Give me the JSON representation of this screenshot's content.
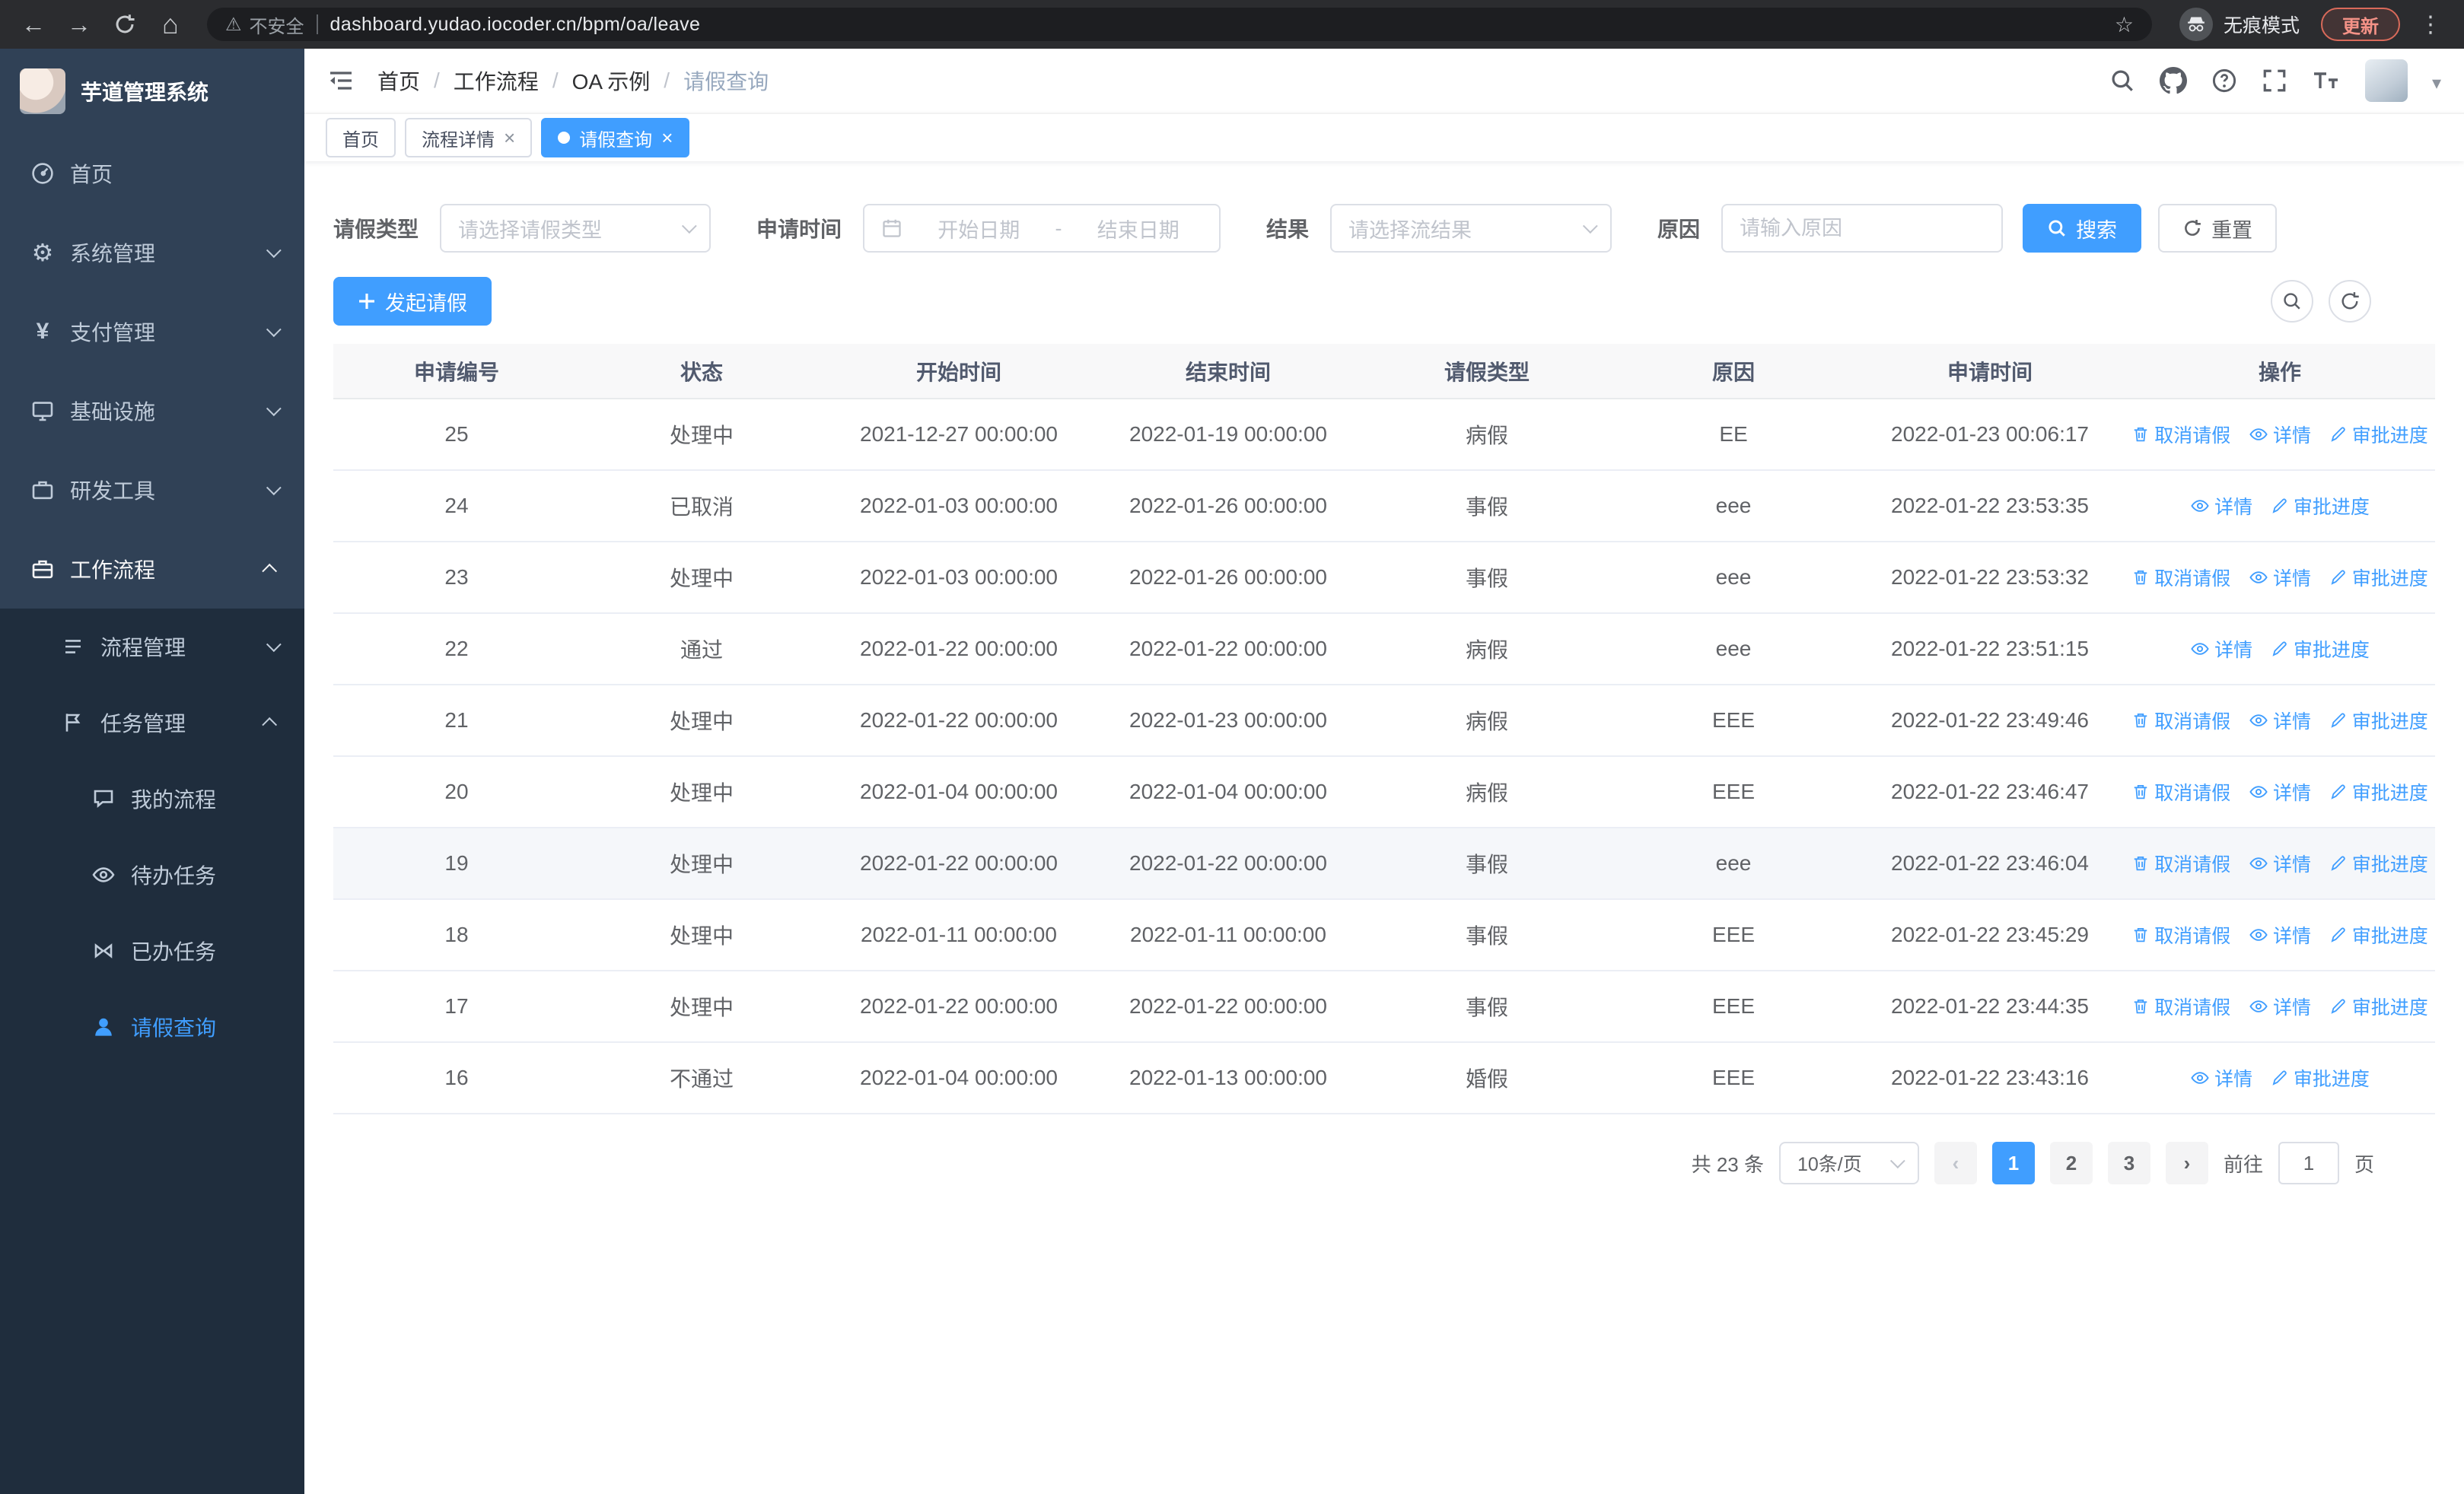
{
  "browser": {
    "security_label": "不安全",
    "url": "dashboard.yudao.iocoder.cn/bpm/oa/leave",
    "incognito_label": "无痕模式",
    "update_label": "更新"
  },
  "sidebar": {
    "title": "芋道管理系统",
    "menu": [
      {
        "label": "首页",
        "icon": "dashboard-icon"
      },
      {
        "label": "系统管理",
        "icon": "gear-icon"
      },
      {
        "label": "支付管理",
        "icon": "yen-icon"
      },
      {
        "label": "基础设施",
        "icon": "infrastructure-icon"
      },
      {
        "label": "研发工具",
        "icon": "tools-icon"
      },
      {
        "label": "工作流程",
        "icon": "workflow-icon"
      }
    ],
    "submenu": [
      {
        "label": "流程管理",
        "icon": "process-icon"
      },
      {
        "label": "任务管理",
        "icon": "task-icon"
      }
    ],
    "task_children": [
      {
        "label": "我的流程",
        "icon": "chat-icon"
      },
      {
        "label": "待办任务",
        "icon": "eye-icon"
      },
      {
        "label": "已办任务",
        "icon": "done-icon"
      },
      {
        "label": "请假查询",
        "icon": "user-icon",
        "active": true
      }
    ]
  },
  "header": {
    "breadcrumb": [
      "首页",
      "工作流程",
      "OA 示例",
      "请假查询"
    ]
  },
  "tabs": [
    {
      "label": "首页"
    },
    {
      "label": "流程详情",
      "closable": true
    },
    {
      "label": "请假查询",
      "closable": true,
      "active": true
    }
  ],
  "filters": {
    "leave_type_label": "请假类型",
    "leave_type_placeholder": "请选择请假类型",
    "apply_time_label": "申请时间",
    "start_date_placeholder": "开始日期",
    "date_separator": "-",
    "end_date_placeholder": "结束日期",
    "result_label": "结果",
    "result_placeholder": "请选择流结果",
    "reason_label": "原因",
    "reason_placeholder": "请输入原因",
    "search_button": "搜索",
    "reset_button": "重置"
  },
  "toolbar": {
    "create_button": "发起请假"
  },
  "table": {
    "columns": [
      "申请编号",
      "状态",
      "开始时间",
      "结束时间",
      "请假类型",
      "原因",
      "申请时间",
      "操作"
    ],
    "actions": {
      "cancel": "取消请假",
      "detail": "详情",
      "progress": "审批进度"
    },
    "rows": [
      {
        "id": "25",
        "status": "处理中",
        "start": "2021-12-27 00:00:00",
        "end": "2022-01-19 00:00:00",
        "type": "病假",
        "reason": "EE",
        "applied": "2022-01-23 00:06:17",
        "cancellable": true
      },
      {
        "id": "24",
        "status": "已取消",
        "start": "2022-01-03 00:00:00",
        "end": "2022-01-26 00:00:00",
        "type": "事假",
        "reason": "eee",
        "applied": "2022-01-22 23:53:35",
        "cancellable": false
      },
      {
        "id": "23",
        "status": "处理中",
        "start": "2022-01-03 00:00:00",
        "end": "2022-01-26 00:00:00",
        "type": "事假",
        "reason": "eee",
        "applied": "2022-01-22 23:53:32",
        "cancellable": true
      },
      {
        "id": "22",
        "status": "通过",
        "start": "2022-01-22 00:00:00",
        "end": "2022-01-22 00:00:00",
        "type": "病假",
        "reason": "eee",
        "applied": "2022-01-22 23:51:15",
        "cancellable": false
      },
      {
        "id": "21",
        "status": "处理中",
        "start": "2022-01-22 00:00:00",
        "end": "2022-01-23 00:00:00",
        "type": "病假",
        "reason": "EEE",
        "applied": "2022-01-22 23:49:46",
        "cancellable": true
      },
      {
        "id": "20",
        "status": "处理中",
        "start": "2022-01-04 00:00:00",
        "end": "2022-01-04 00:00:00",
        "type": "病假",
        "reason": "EEE",
        "applied": "2022-01-22 23:46:47",
        "cancellable": true
      },
      {
        "id": "19",
        "status": "处理中",
        "start": "2022-01-22 00:00:00",
        "end": "2022-01-22 00:00:00",
        "type": "事假",
        "reason": "eee",
        "applied": "2022-01-22 23:46:04",
        "cancellable": true,
        "highlighted": true
      },
      {
        "id": "18",
        "status": "处理中",
        "start": "2022-01-11 00:00:00",
        "end": "2022-01-11 00:00:00",
        "type": "事假",
        "reason": "EEE",
        "applied": "2022-01-22 23:45:29",
        "cancellable": true
      },
      {
        "id": "17",
        "status": "处理中",
        "start": "2022-01-22 00:00:00",
        "end": "2022-01-22 00:00:00",
        "type": "事假",
        "reason": "EEE",
        "applied": "2022-01-22 23:44:35",
        "cancellable": true
      },
      {
        "id": "16",
        "status": "不通过",
        "start": "2022-01-04 00:00:00",
        "end": "2022-01-13 00:00:00",
        "type": "婚假",
        "reason": "EEE",
        "applied": "2022-01-22 23:43:16",
        "cancellable": false
      }
    ]
  },
  "pagination": {
    "total_text": "共 23 条",
    "page_size_text": "10条/页",
    "pages": [
      "1",
      "2",
      "3"
    ],
    "active_page": "1",
    "goto_prefix": "前往",
    "goto_value": "1",
    "goto_suffix": "页"
  }
}
